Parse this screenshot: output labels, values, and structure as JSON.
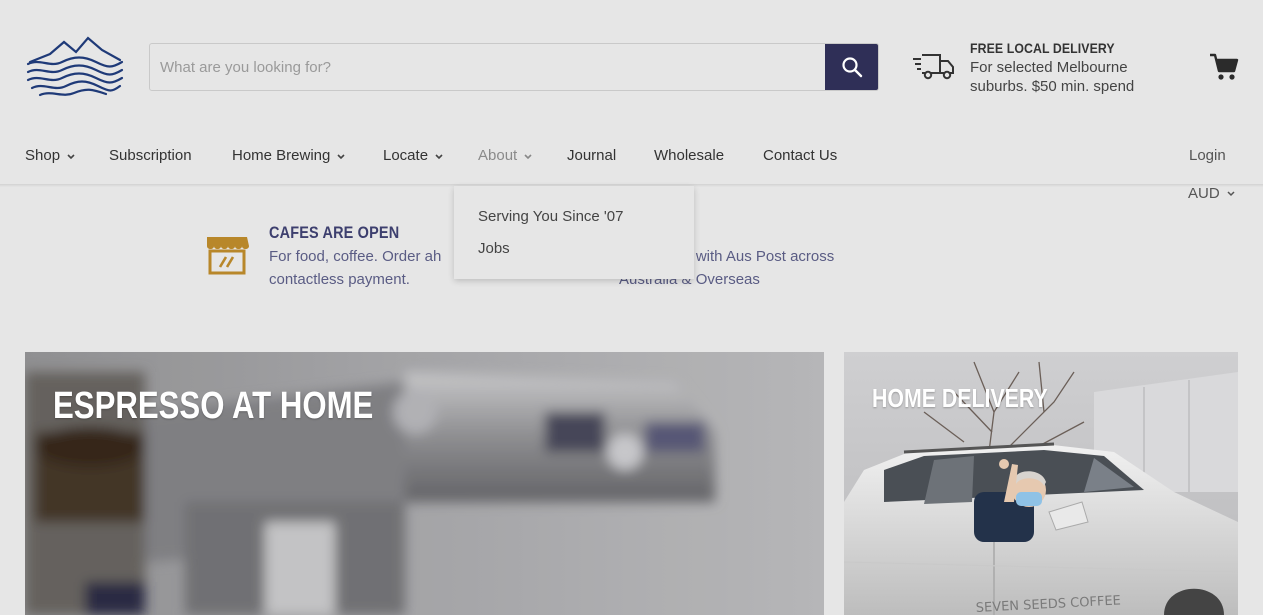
{
  "header": {
    "logo_name": "mountain-waves-logo",
    "search": {
      "placeholder": "What are you looking for?",
      "value": ""
    },
    "promo": {
      "title": "FREE LOCAL DELIVERY",
      "text": "For selected Melbourne suburbs. $50 min. spend"
    }
  },
  "nav": {
    "items": [
      {
        "label": "Shop",
        "has_dropdown": true
      },
      {
        "label": "Subscription",
        "has_dropdown": false
      },
      {
        "label": "Home Brewing",
        "has_dropdown": true
      },
      {
        "label": "Locate",
        "has_dropdown": true
      },
      {
        "label": "About",
        "has_dropdown": true,
        "active": true
      },
      {
        "label": "Journal",
        "has_dropdown": false
      },
      {
        "label": "Wholesale",
        "has_dropdown": false
      },
      {
        "label": "Contact Us",
        "has_dropdown": false
      }
    ],
    "login": "Login",
    "currency": "AUD"
  },
  "about_dropdown": {
    "items": [
      "Serving You Since '07",
      "Jobs"
    ]
  },
  "info_strip": {
    "cafes": {
      "title": "CAFES ARE OPEN",
      "line1": "For food, coffee. Order ah",
      "line2": "contactless payment."
    },
    "shipping": {
      "line1": "ng with Aus Post across",
      "line2": "Australia & Overseas"
    }
  },
  "tiles": {
    "espresso": {
      "title": "ESPRESSO AT HOME"
    },
    "delivery": {
      "title": "HOME DELIVERY",
      "van_text": "SEVEN SEEDS COFFEE"
    }
  },
  "colors": {
    "brand_navy": "#2f2f57",
    "logo_blue": "#1f3a78",
    "info_gold": "#b8872a",
    "info_text": "#5a5c84",
    "background": "#e6e6e6"
  }
}
